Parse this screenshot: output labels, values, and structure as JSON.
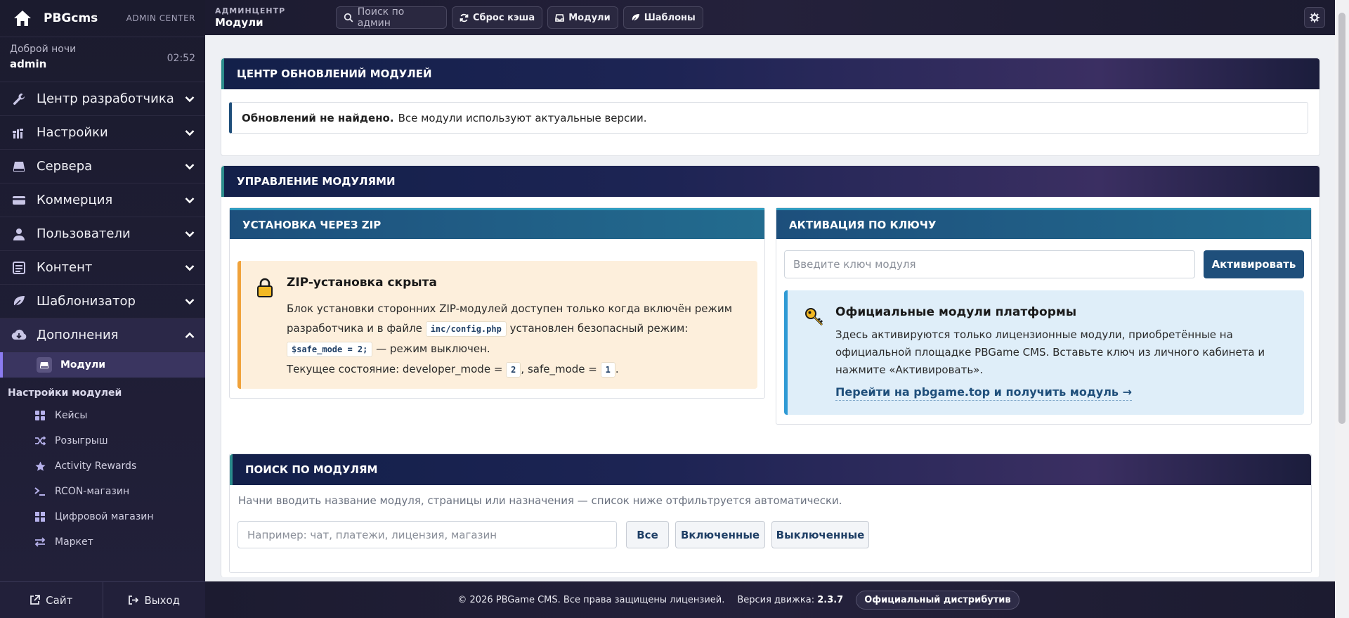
{
  "brand": {
    "name": "PBGcms",
    "admin_center": "ADMIN CENTER"
  },
  "greeting": {
    "hello": "Доброй ночи",
    "user": "admin",
    "time": "02:52"
  },
  "sidebar": {
    "items": [
      {
        "label": "Центр разработчика",
        "icon": "wrench-icon"
      },
      {
        "label": "Настройки",
        "icon": "sliders-icon"
      },
      {
        "label": "Сервера",
        "icon": "hdd-icon"
      },
      {
        "label": "Коммерция",
        "icon": "credit-card-icon"
      },
      {
        "label": "Пользователи",
        "icon": "user-icon"
      },
      {
        "label": "Контент",
        "icon": "document-icon"
      },
      {
        "label": "Шаблонизатор",
        "icon": "leaf-icon"
      },
      {
        "label": "Дополнения",
        "icon": "cloud-download-icon"
      }
    ],
    "active_sub": "Модули",
    "section_label": "Настройки модулей",
    "module_items": [
      {
        "label": "Кейсы",
        "icon": "grid-icon"
      },
      {
        "label": "Розыгрыш",
        "icon": "shuffle-icon"
      },
      {
        "label": "Activity Rewards",
        "icon": "star-icon"
      },
      {
        "label": "RCON-магазин",
        "icon": "terminal-icon"
      },
      {
        "label": "Цифровой магазин",
        "icon": "apps-icon"
      },
      {
        "label": "Маркет",
        "icon": "exchange-icon"
      }
    ],
    "footer": {
      "site": "Сайт",
      "logout": "Выход"
    }
  },
  "topbar": {
    "crumb_small": "АДМИНЦЕНТР",
    "crumb_big": "Модули",
    "search_placeholder": "Поиск по админ",
    "reset_cache": "Сброс кэша",
    "modules": "Модули",
    "templates": "Шаблоны"
  },
  "updates": {
    "title": "ЦЕНТР ОБНОВЛЕНИЙ МОДУЛЕЙ",
    "status_bold": "Обновлений не найдено.",
    "status_text": "Все модули используют актуальные версии."
  },
  "management": {
    "title": "УПРАВЛЕНИЕ МОДУЛЯМИ",
    "zip": {
      "title": "УСТАНОВКА ЧЕРЕЗ ZIP",
      "box_title": "ZIP-установка скрыта",
      "text1": "Блок установки сторонних ZIP-модулей доступен только когда включён режим разработчика и в файле",
      "code1": "inc/config.php",
      "text2": "установлен безопасный режим:",
      "code2": "$safe_mode = 2;",
      "text3": "— режим выключен.",
      "state_text": "Текущее состояние: developer_mode =",
      "dev_mode": "2",
      "safe_text": ", safe_mode =",
      "safe_mode": "1",
      "dot": "."
    },
    "key": {
      "title": "АКТИВАЦИЯ ПО КЛЮЧУ",
      "placeholder": "Введите ключ модуля",
      "button": "Активировать",
      "box_title": "Официальные модули платформы",
      "box_text": "Здесь активируются только лицензионные модули, приобретённые на официальной площадке PBGame CMS. Вставьте ключ из личного кабинета и нажмите «Активировать».",
      "link": "Перейти на pbgame.top и получить модуль →"
    }
  },
  "search": {
    "title": "ПОИСК ПО МОДУЛЯМ",
    "hint": "Начни вводить название модуля, страницы или назначения — список ниже отфильтруется автоматически.",
    "placeholder": "Например: чат, платежи, лицензия, магазин",
    "all": "Все",
    "enabled": "Включенные",
    "disabled": "Выключенные"
  },
  "footer": {
    "copyright": "© 2026 PBGame CMS. Все права защищены лицензией.",
    "version_label": "Версия движка:",
    "version": "2.3.7",
    "distribution": "Официальный дистрибутив"
  }
}
